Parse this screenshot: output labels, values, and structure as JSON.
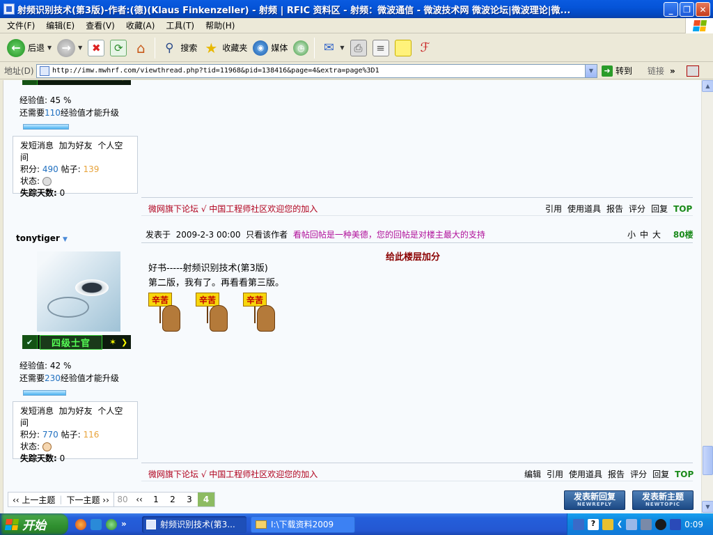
{
  "window": {
    "title": "射频识别技术(第3版)-作者:(德)(Klaus Finkenzeller) - 射频 | RFIC 资料区 - 射频：微波通信 - 微波技术网 微波论坛|微波理论|微..."
  },
  "menu": [
    "文件(F)",
    "编辑(E)",
    "查看(V)",
    "收藏(A)",
    "工具(T)",
    "帮助(H)"
  ],
  "toolbar": {
    "back": "后退",
    "search": "搜索",
    "favorites": "收藏夹",
    "media": "媒体"
  },
  "address": {
    "label": "地址(D)",
    "url": "http://imw.mwhrf.com/viewthread.php?tid=11968&pid=138416&page=4&extra=page%3D1",
    "go": "转到",
    "links": "链接"
  },
  "post1": {
    "exp_label": "经验值: 45 %",
    "exp_percent": 45,
    "need_prefix": "还需要",
    "need_value": "110",
    "need_suffix": "经验值才能升级",
    "actions": [
      "发短消息",
      "加为好友",
      "个人空间"
    ],
    "points_label": "积分:",
    "points": "490",
    "posts_label": "帖子:",
    "posts": "139",
    "status_label": "状态:",
    "missing_label": "失踪天数:",
    "missing": "0",
    "signature": "微网旗下论坛 √ 中国工程师社区欢迎您的加入",
    "footer_actions": [
      "引用",
      "使用道具",
      "报告",
      "评分",
      "回复"
    ],
    "top": "TOP"
  },
  "post2": {
    "username": "tonytiger",
    "rank": "四级士官",
    "posted_label": "发表于",
    "posted_at": "2009-2-3 00:00",
    "only_author": "只看该作者",
    "motto": "看帖回帖是一种美德，您的回帖是对楼主最大的支持",
    "sizes": [
      "小",
      "中",
      "大"
    ],
    "floor": "80楼",
    "rate_heading": "给此楼层加分",
    "line1": "好书-----射频识别技术(第3版)",
    "line2": "第二版，我有了。再看看第三版。",
    "sign_text": "辛苦",
    "exp_label": "经验值: 42 %",
    "exp_percent": 42,
    "need_prefix": "还需要",
    "need_value": "230",
    "need_suffix": "经验值才能升级",
    "actions": [
      "发短消息",
      "加为好友",
      "个人空间"
    ],
    "points_label": "积分:",
    "points": "770",
    "posts_label": "帖子:",
    "posts": "116",
    "status_label": "状态:",
    "missing_label": "失踪天数:",
    "missing": "0",
    "signature": "微网旗下论坛 √ 中国工程师社区欢迎您的加入",
    "footer_actions": [
      "编辑",
      "引用",
      "使用道具",
      "报告",
      "评分",
      "回复"
    ],
    "top": "TOP"
  },
  "nav": {
    "prev": "‹‹ 上一主题",
    "next": "下一主题 ››",
    "pages": [
      "80",
      "‹‹",
      "1",
      "2",
      "3",
      "4"
    ],
    "current": "4",
    "new_reply": "发表新回复",
    "new_reply_en": "NEWREPLY",
    "new_topic": "发表新主题",
    "new_topic_en": "NEWTOPIC"
  },
  "taskbar": {
    "start": "开始",
    "task1": "射频识别技术(第3...",
    "task2": "I:\\下载资料2009",
    "clock": "0:09"
  }
}
